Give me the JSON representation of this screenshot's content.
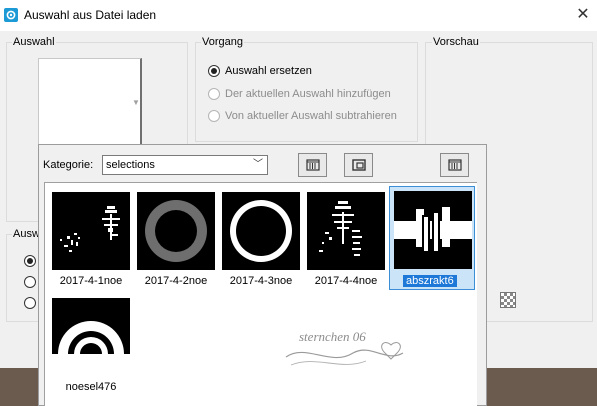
{
  "window": {
    "title": "Auswahl aus Datei laden",
    "close_glyph": "✕",
    "icon": "psp-app-icon"
  },
  "groups": {
    "auswahl": "Auswahl",
    "vorgang": "Vorgang",
    "vorschau": "Vorschau",
    "lower_partial": "Ausw"
  },
  "vorgang_options": [
    {
      "label": "Auswahl ersetzen",
      "checked": true,
      "enabled": true
    },
    {
      "label": "Der aktuellen Auswahl hinzufügen",
      "checked": false,
      "enabled": false
    },
    {
      "label": "Von aktueller Auswahl subtrahieren",
      "checked": false,
      "enabled": false
    }
  ],
  "browser": {
    "category_label": "Kategorie:",
    "category_value": "selections",
    "tool_icons": [
      "list-view-icon",
      "folder-view-icon",
      "browse-icon"
    ],
    "thumbnails": [
      {
        "label": "2017-4-1noe",
        "selected": false
      },
      {
        "label": "2017-4-2noe",
        "selected": false
      },
      {
        "label": "2017-4-3noe",
        "selected": false
      },
      {
        "label": "2017-4-4noe",
        "selected": false
      },
      {
        "label": "abszrakt6",
        "selected": true
      },
      {
        "label": "noesel476",
        "selected": false
      }
    ]
  },
  "watermark_text": "sternchen 06",
  "colors": {
    "selected_bg": "#cce4f7",
    "selected_label": "#1e78d7",
    "title_icon": "#1b9ad6"
  }
}
